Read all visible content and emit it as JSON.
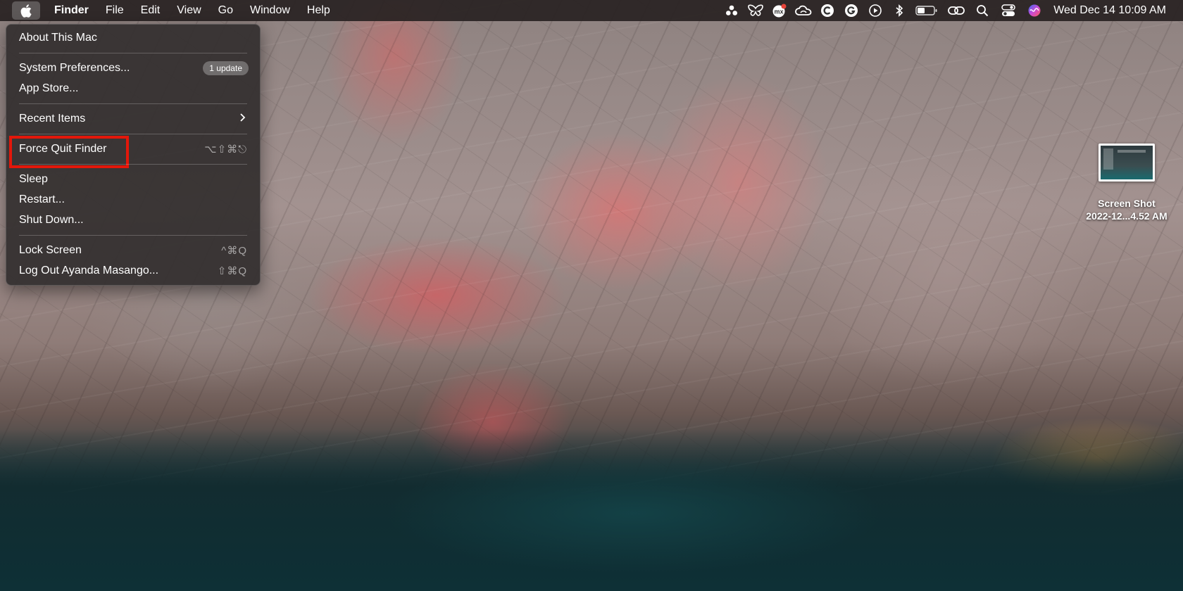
{
  "menubar": {
    "app_name": "Finder",
    "menus": [
      "File",
      "Edit",
      "View",
      "Go",
      "Window",
      "Help"
    ],
    "status_icons": [
      "creative-cloud-dots-icon",
      "butterfly-icon",
      "mx-icon",
      "adobe-cloud-icon",
      "c-circle-icon",
      "grammarly-icon",
      "play-circle-icon",
      "bluetooth-icon",
      "battery-icon",
      "link-icon",
      "search-icon",
      "control-center-icon",
      "siri-icon"
    ],
    "clock": "Wed Dec 14  10:09 AM"
  },
  "apple_menu": {
    "about": "About This Mac",
    "system_prefs": "System Preferences...",
    "update_badge": "1 update",
    "app_store": "App Store...",
    "recent_items": "Recent Items",
    "force_quit": "Force Quit Finder",
    "force_quit_shortcut": "⌥⇧⌘⎋",
    "sleep": "Sleep",
    "restart": "Restart...",
    "shut_down": "Shut Down...",
    "lock_screen": "Lock Screen",
    "lock_shortcut": "^⌘Q",
    "log_out": "Log Out Ayanda Masango...",
    "log_out_shortcut": "⇧⌘Q"
  },
  "desktop": {
    "file_line1": "Screen Shot",
    "file_line2": "2022-12...4.52 AM"
  },
  "colors": {
    "highlight_box": "#e3170a"
  }
}
